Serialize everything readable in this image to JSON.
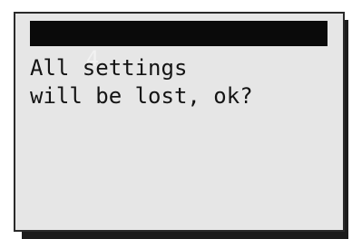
{
  "screen": {
    "title": "4",
    "message_line_1": "All settings",
    "message_line_2": "will be lost, ok?"
  },
  "colors": {
    "lcd_background": "#e6e6e6",
    "title_bar_background": "#0a0a0a",
    "title_text": "#f2f2f2",
    "text": "#141414"
  }
}
